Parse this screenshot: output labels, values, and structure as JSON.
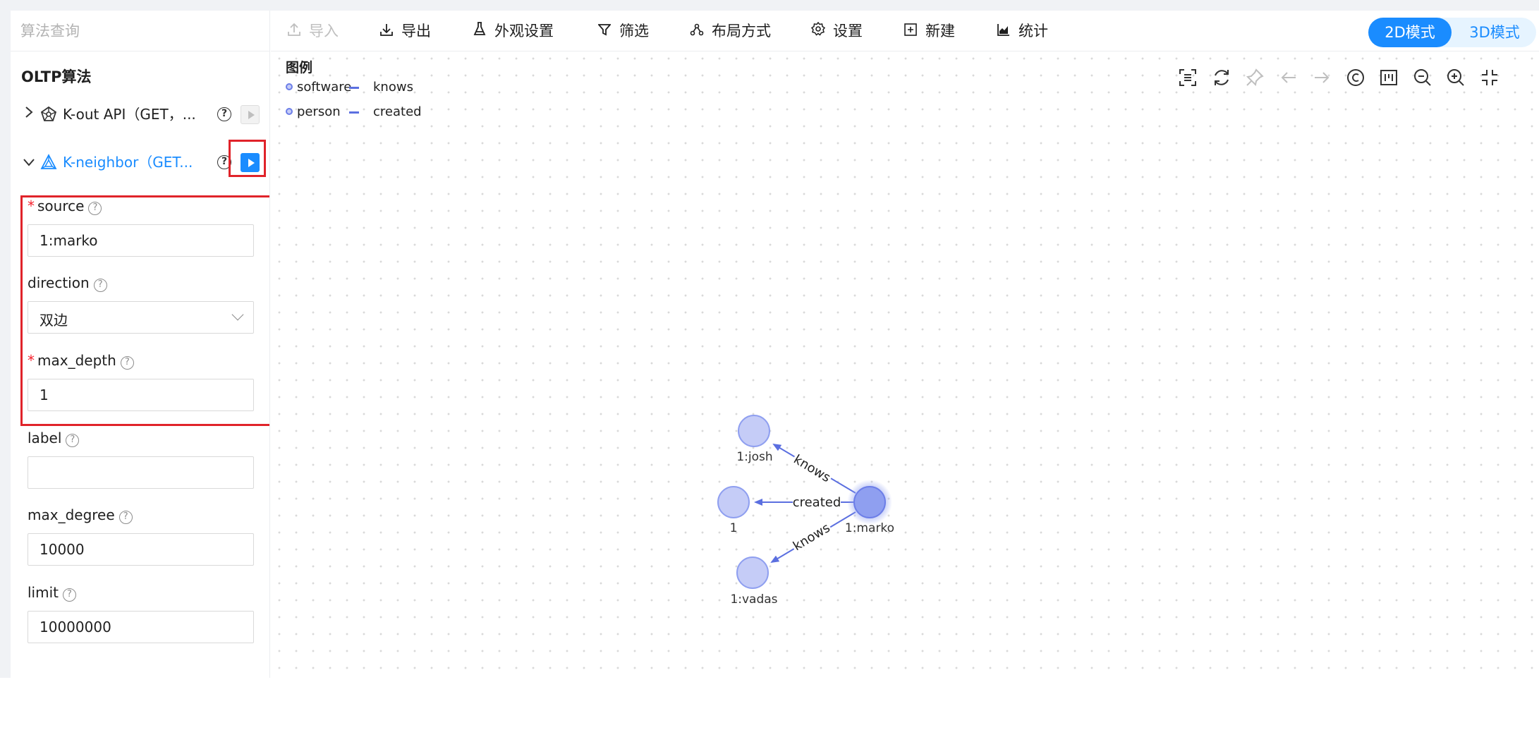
{
  "sidebar": {
    "search_placeholder": "算法查询",
    "heading": "OLTP算法",
    "algorithms": [
      {
        "label": "K-out API（GET，...",
        "icon": "kout-icon",
        "expanded": false
      },
      {
        "label": "K-neighbor（GET...",
        "icon": "kneighbor-icon",
        "expanded": true
      }
    ],
    "fields": {
      "source": {
        "label": "source",
        "required": true,
        "value": "1:marko"
      },
      "direction": {
        "label": "direction",
        "required": false,
        "value": "双边"
      },
      "max_depth": {
        "label": "max_depth",
        "required": true,
        "value": "1"
      },
      "label": {
        "label": "label",
        "required": false,
        "value": ""
      },
      "max_degree": {
        "label": "max_degree",
        "required": false,
        "value": "10000"
      },
      "limit": {
        "label": "limit",
        "required": false,
        "value": "10000000"
      }
    },
    "required_mark": "*",
    "help_glyph": "?"
  },
  "toolbar": {
    "items": [
      {
        "label": "导入",
        "icon": "upload-icon",
        "disabled": true
      },
      {
        "label": "导出",
        "icon": "download-icon",
        "disabled": false
      },
      {
        "label": "外观设置",
        "icon": "flask-icon",
        "disabled": false
      },
      {
        "label": "筛选",
        "icon": "filter-icon",
        "disabled": false
      },
      {
        "label": "布局方式",
        "icon": "layout-icon",
        "disabled": false
      },
      {
        "label": "设置",
        "icon": "gear-icon",
        "disabled": false
      },
      {
        "label": "新建",
        "icon": "plus-square-icon",
        "disabled": false
      },
      {
        "label": "统计",
        "icon": "chart-icon",
        "disabled": false
      }
    ],
    "mode": {
      "active": "2D模式",
      "inactive": "3D模式"
    }
  },
  "legend": {
    "title": "图例",
    "vertex_types": [
      "software",
      "person"
    ],
    "edge_types": [
      "knows",
      "created"
    ]
  },
  "graph_tools": [
    "fit-view-icon",
    "refresh-icon",
    "pin-icon",
    "undo-icon",
    "redo-icon",
    "copyright-icon",
    "ruler-icon",
    "zoom-out-icon",
    "zoom-in-icon",
    "fullscreen-exit-icon"
  ],
  "graph": {
    "nodes": [
      {
        "id": "1:marko",
        "label": "1:marko",
        "selected": true
      },
      {
        "id": "1:josh",
        "label": "1:josh",
        "selected": false
      },
      {
        "id": "1",
        "label": "1",
        "selected": false
      },
      {
        "id": "1:vadas",
        "label": "1:vadas",
        "selected": false
      }
    ],
    "edges": [
      {
        "source": "1:marko",
        "target": "1:josh",
        "label": "knows"
      },
      {
        "source": "1:marko",
        "target": "1",
        "label": "created"
      },
      {
        "source": "1:marko",
        "target": "1:vadas",
        "label": "knows"
      }
    ]
  },
  "colors": {
    "accent": "#1a8cff",
    "highlight": "#e0232a",
    "node_fill": "#c5ccf7",
    "node_stroke": "#6c7ee8",
    "selected_node_fill": "#8f9ff0",
    "edge": "#5b6fe0"
  }
}
